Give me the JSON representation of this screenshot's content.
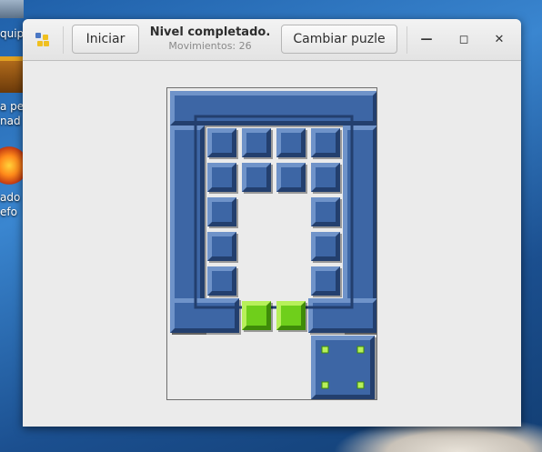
{
  "desktop": {
    "label_1": "quip",
    "label_2": "a pe",
    "label_3": "nad",
    "label_4": "ado",
    "label_5": "efo"
  },
  "toolbar": {
    "app_icon": "puzzle-app-icon",
    "start_label": "Iniciar",
    "status_title": "Nivel completado.",
    "moves_text": "Movimientos: 26",
    "change_puzzle_label": "Cambiar puzle",
    "minimize_icon": "minimize-icon",
    "maximize_icon": "maximize-icon",
    "close_icon": "close-icon"
  },
  "board": {
    "colors": {
      "block": "#3d66a5",
      "block_light": "#6f93c9",
      "block_dark": "#233f6e",
      "goal": "#6fcf1b",
      "goal_light": "#b7f05a",
      "goal_dark": "#3f8b09"
    },
    "grid": {
      "cols": 6,
      "rows": 9
    },
    "walls": [
      {
        "id": "wall-top",
        "r": 0,
        "c": 0,
        "w": 6,
        "h": 1
      },
      {
        "id": "wall-left",
        "r": 1,
        "c": 0,
        "w": 1,
        "h": 6
      },
      {
        "id": "wall-right",
        "r": 1,
        "c": 5,
        "w": 1,
        "h": 6
      },
      {
        "id": "wall-bottom-left",
        "r": 6,
        "c": 0,
        "w": 2,
        "h": 1
      },
      {
        "id": "wall-bottom-right",
        "r": 6,
        "c": 4,
        "w": 2,
        "h": 1
      }
    ],
    "small_blocks": [
      {
        "r": 1,
        "c": 1
      },
      {
        "r": 1,
        "c": 2
      },
      {
        "r": 1,
        "c": 3
      },
      {
        "r": 1,
        "c": 4
      },
      {
        "r": 2,
        "c": 1
      },
      {
        "r": 2,
        "c": 2
      },
      {
        "r": 2,
        "c": 3
      },
      {
        "r": 2,
        "c": 4
      },
      {
        "r": 3,
        "c": 1
      },
      {
        "r": 3,
        "c": 4
      },
      {
        "r": 4,
        "c": 1
      },
      {
        "r": 4,
        "c": 4
      },
      {
        "r": 5,
        "c": 1
      },
      {
        "r": 5,
        "c": 4
      }
    ],
    "goal_blocks": [
      {
        "r": 6,
        "c": 2
      },
      {
        "r": 6,
        "c": 3
      }
    ],
    "target_block": {
      "r": 7,
      "c": 4,
      "w": 2,
      "h": 2
    }
  }
}
